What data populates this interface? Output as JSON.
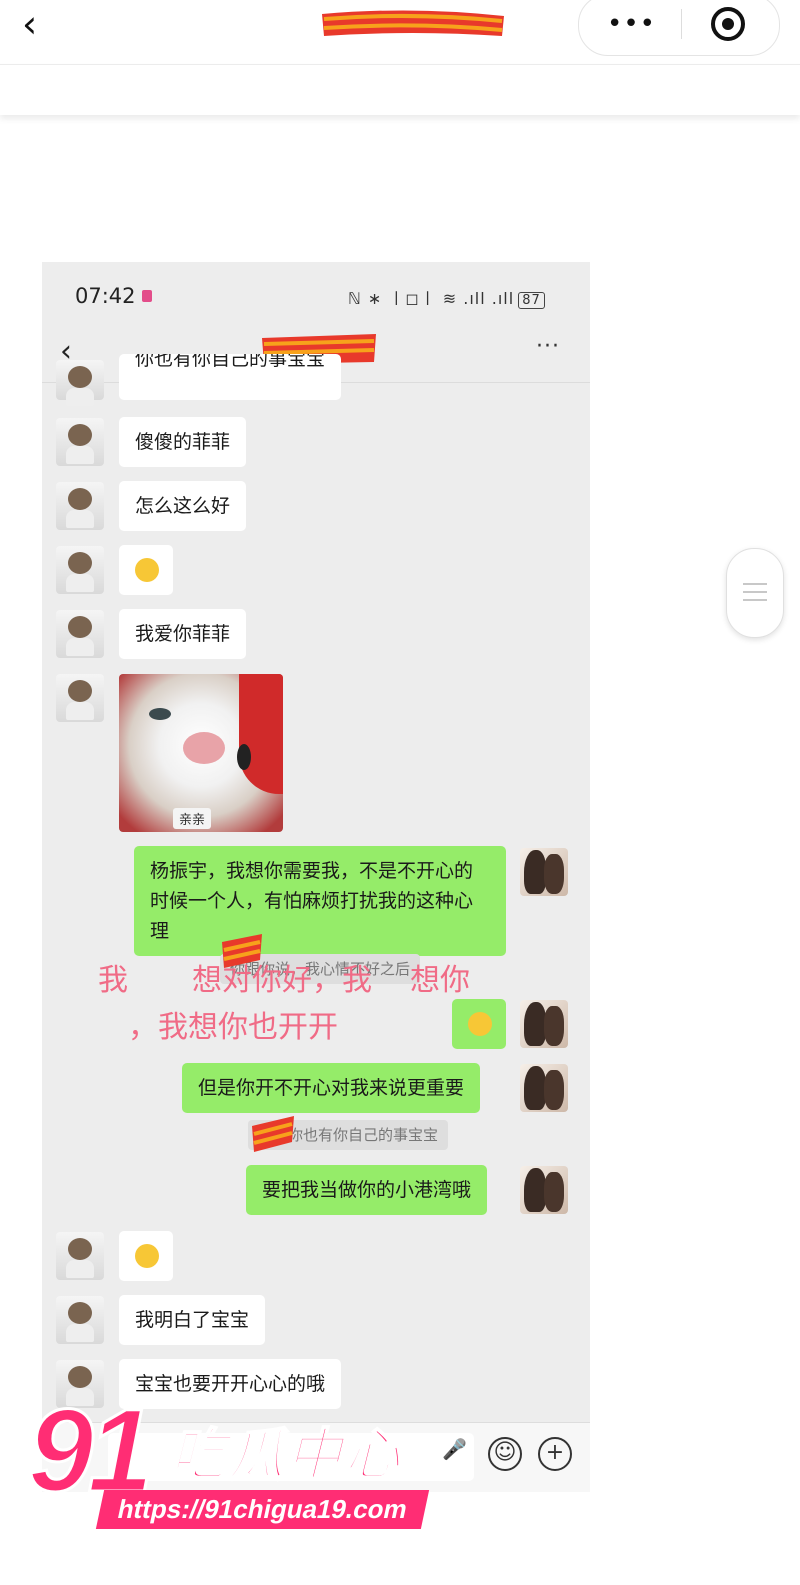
{
  "topbar": {
    "back_icon": "chevron-left-icon",
    "more_label": "•••",
    "target_icon": "target-icon"
  },
  "phone": {
    "status": {
      "time": "07:42",
      "battery": "87",
      "icons": "ℕ ∗ 〡◻〡 ≋ .ıll .ıll"
    },
    "chat_header": {
      "back_icon": "chevron-left-icon",
      "more_label": "···"
    },
    "messages": {
      "m0": "你也有你自己的事宝宝",
      "m1": "傻傻的菲菲",
      "m2": "怎么这么好",
      "m4": "我爱你菲菲",
      "sticker_label": "亲亲",
      "r1": "杨振宇，我想你需要我，不是不开心的时候一个人，有怕麻烦打扰我的这种心理",
      "r1_quote": "你跟你说，我心情不好之后",
      "r3": "但是你开不开心对我来说更重要",
      "r3_quote": "宇：你也有你自己的事宝宝",
      "r4": "要把我当做你的小港湾哦",
      "m6": "我明白了宝宝",
      "m7": "宝宝也要开开心心的哦"
    }
  },
  "overlay": {
    "line1a": "我",
    "line1b": "想对你好，我",
    "line1c": "想你",
    "line2": "，我想你也开开"
  },
  "watermark": {
    "number": "91",
    "title": "吃瓜中心",
    "url": "https://91chigua19.com"
  }
}
